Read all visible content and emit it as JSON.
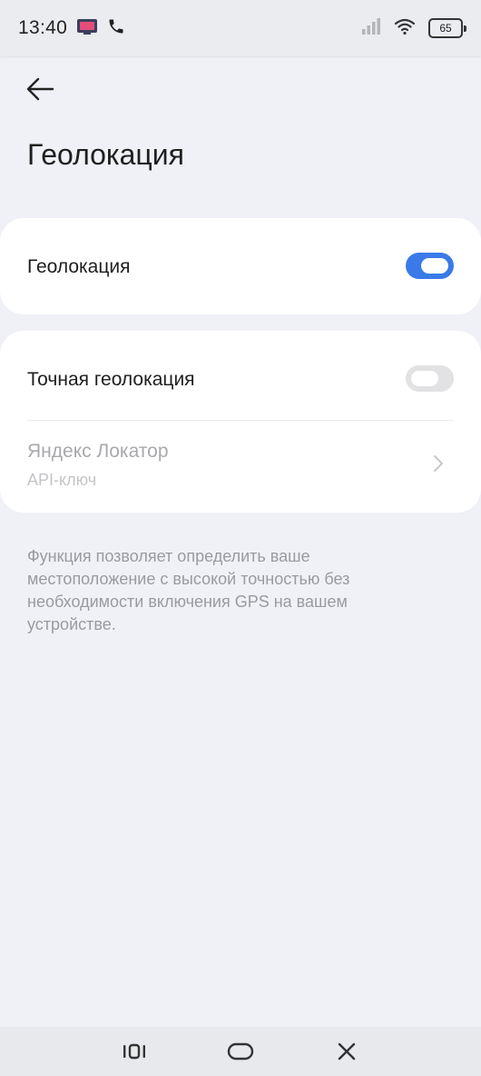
{
  "status_bar": {
    "time": "13:40",
    "battery": "65",
    "icons": [
      "app-icon",
      "phone-icon",
      "signal-icon",
      "wifi-icon",
      "battery-icon"
    ]
  },
  "header": {
    "back_icon": "arrow-left-icon",
    "title": "Геолокация"
  },
  "location_card": {
    "label": "Геолокация",
    "enabled": true
  },
  "precise_card": {
    "label": "Точная геолокация",
    "enabled": false,
    "locator_title": "Яндекс Локатор",
    "locator_subtitle": "API-ключ",
    "chevron_icon": "chevron-right-icon"
  },
  "description": "Функция позволяет определить ваше местоположение с высокой точностью без необходимости включения GPS на вашем устройстве.",
  "nav_bar": {
    "icons": [
      "recent-apps-icon",
      "home-icon",
      "back-close-icon"
    ]
  },
  "colors": {
    "accent": "#3a7ae8",
    "background": "#f0f1f6",
    "card": "#ffffff",
    "muted_text": "#9a9aa0"
  }
}
